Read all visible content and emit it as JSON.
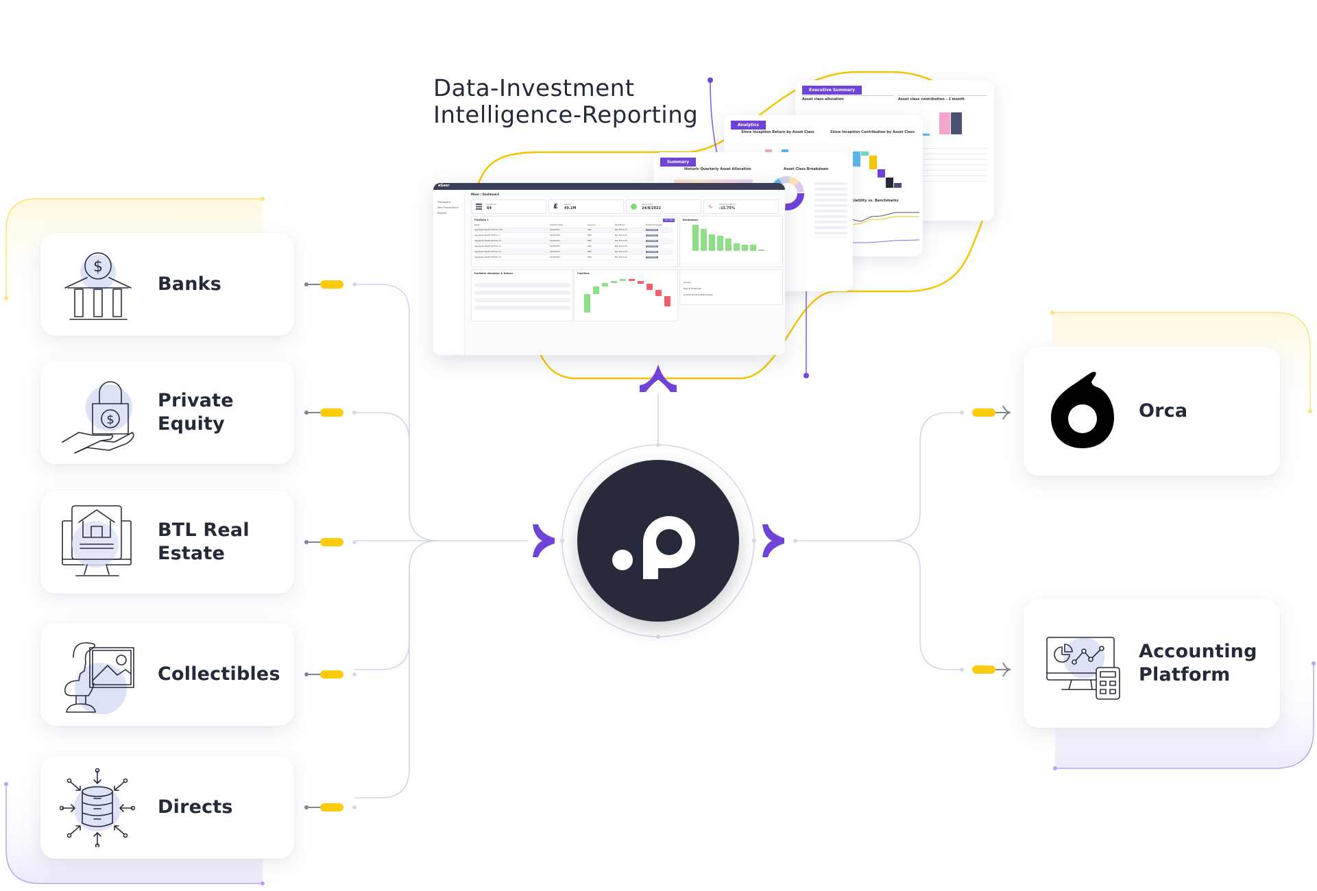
{
  "headline": {
    "line1": "Data-Investment",
    "line2": "Intelligence-Reporting"
  },
  "colors": {
    "accent_purple": "#6f42d8",
    "accent_yellow": "#fccb0b",
    "dark": "#262a3a",
    "icon_bubble": "#dde2f6",
    "wire": "#cfd5e8"
  },
  "sources": [
    {
      "label": "Banks",
      "icon": "bank-icon"
    },
    {
      "label": "Private Equity",
      "line1": "Private",
      "line2": "Equity",
      "icon": "locked-money-hand-icon"
    },
    {
      "label": "BTL Real Estate",
      "line1": "BTL Real",
      "line2": "Estate",
      "icon": "property-listing-icon"
    },
    {
      "label": "Collectibles",
      "icon": "art-collectibles-icon"
    },
    {
      "label": "Directs",
      "icon": "database-inflow-icon"
    }
  ],
  "hub": {
    "logo_text": ".p",
    "icon": "platform-logo"
  },
  "destinations": [
    {
      "label": "Orca",
      "icon": "orca-logo"
    },
    {
      "label": "Accounting Platform",
      "line1": "Accounting",
      "line2": "Platform",
      "icon": "accounting-monitor-calculator-icon"
    }
  ],
  "reports": {
    "executive": {
      "tag": "Executive Summary",
      "left_title": "Asset class allocation",
      "right_title": "Asset class contribution - 1 month"
    },
    "analytics": {
      "tag": "Analytics",
      "left_title": "Since Inception Return by Asset Class",
      "right_title": "Since Inception Contribution by Asset Class",
      "lower_title": "Annualised Volatility vs. Benchmarks"
    },
    "summary": {
      "tag": "Summary",
      "left_title": "Historic Quarterly Asset Allocation",
      "right_title": "Asset Class Breakdown"
    }
  },
  "dashboard": {
    "brand": "aGeer",
    "breadcrumb": "Mizer / Dashboard",
    "sidebar": [
      "Dashboard",
      "New Transactions",
      "Reports"
    ],
    "stats": [
      {
        "key": "Portfolios",
        "value": "64"
      },
      {
        "key": "Assets",
        "value": "49.2M"
      },
      {
        "key": "Value Date",
        "value": "24/8/2022"
      },
      {
        "key": "Worst 1D Return",
        "value": "-13.75%"
      }
    ],
    "table": {
      "search": "Portfolio 1",
      "add_label": "ADD NEW",
      "columns": [
        "Name",
        "Inception Date",
        "Currency",
        "Beneficiary",
        "Simple/Composite"
      ],
      "rows": [
        [
          "Aggregate Wealth Portfolio 106",
          "01/06/2021",
          "GBP",
          "Ben Edmonds",
          "Composite"
        ],
        [
          "Aggregate Wealth Portfolio 1",
          "01/06/2020",
          "GBP",
          "Ben Edmonds",
          "Composite"
        ],
        [
          "Aggregate Wealth Portfolio 10",
          "01/06/2021",
          "GBP",
          "Ben Edmonds",
          "Composite"
        ],
        [
          "Aggregate Wealth Portfolio 11",
          "01/06/2021",
          "GBP",
          "Ben Edmonds",
          "Composite"
        ],
        [
          "Aggregate Wealth Portfolio 12",
          "01/06/2021",
          "GBP",
          "Ben Edmonds",
          "Composite"
        ],
        [
          "Aggregate Wealth Portfolio 13",
          "01/06/2021",
          "GBP",
          "Ben Edmonds",
          "Composite"
        ]
      ]
    },
    "breakdown_title": "Breakdown",
    "valuation_title": "Portfolio Valuation & Return",
    "cashflow_title": "Cashflow",
    "cashflow_items": [
      "Income",
      "Fees & Expenses",
      "Contributions & Withdrawals"
    ],
    "breakdown_bars": [
      0.95,
      0.8,
      0.6,
      0.55,
      0.45,
      0.27,
      0.22,
      0.22,
      0.05,
      0.0
    ],
    "waterfall": [
      {
        "base": 0.0,
        "h": 0.55,
        "pos": true
      },
      {
        "base": 0.55,
        "h": 0.22,
        "pos": true
      },
      {
        "base": 0.77,
        "h": 0.09,
        "pos": true
      },
      {
        "base": 0.86,
        "h": 0.06,
        "pos": true
      },
      {
        "base": 0.92,
        "h": 0.06,
        "pos": true
      },
      {
        "base": 0.92,
        "h": 0.06,
        "pos": false
      },
      {
        "base": 0.84,
        "h": 0.08,
        "pos": false
      },
      {
        "base": 0.66,
        "h": 0.18,
        "pos": false
      },
      {
        "base": 0.48,
        "h": 0.18,
        "pos": false
      },
      {
        "base": 0.18,
        "h": 0.3,
        "pos": false
      }
    ]
  }
}
